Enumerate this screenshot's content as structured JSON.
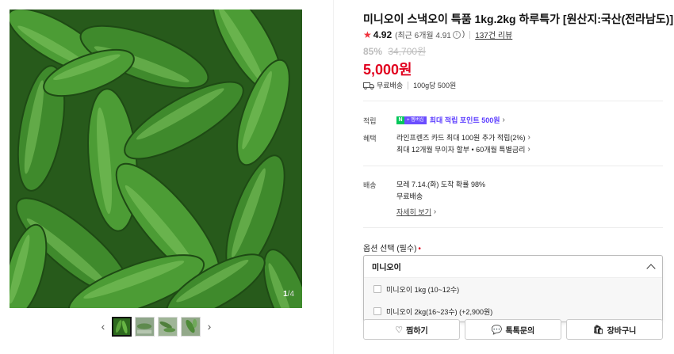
{
  "gallery": {
    "page_current": "1",
    "page_total": "4",
    "page_separator": "/",
    "prev_icon": "chevron-left-icon",
    "next_icon": "chevron-right-icon"
  },
  "product": {
    "title": "미니오이 스낵오이 특품 1kg.2kg 하루특가 [원산지:국산(전라남도)]",
    "rating": "4.92",
    "rating_recent": "(최근 6개월 4.91",
    "rating_recent_close": ")",
    "reviews": "137건 리뷰",
    "discount_rate": "85%",
    "original_price": "34,700원",
    "price": "5,000원",
    "shipping": "무료배송",
    "unit_price": "100g당 500원"
  },
  "benefits": {
    "point_label": "적립",
    "npay_n": "N",
    "npay_plus": "+ 멤버십",
    "point_text": "최대 적립 포인트 500원",
    "benefit_label": "혜택",
    "benefit_line1": "라인프렌즈 카드 최대 100원 추가 적립(2%)",
    "benefit_line2": "최대 12개월 무이자 할부 • 60개월 특별금리"
  },
  "delivery": {
    "label": "배송",
    "eta": "모레 7.14.(화) 도착 확률 98%",
    "fee": "무료배송",
    "detail_link": "자세히 보기"
  },
  "options": {
    "label": "옵션 선택 (필수)",
    "required_mark": "•",
    "selected": "미니오이",
    "items": [
      "미니오이 1kg (10~12수)",
      "미니오이 2kg(16~23수) (+2,900원)"
    ]
  },
  "actions": {
    "wish": "찜하기",
    "talk": "톡톡문의",
    "cart": "장바구니"
  },
  "colors": {
    "price_red": "#e1001f",
    "point_purple": "#5b3cff",
    "npay_green": "#03c75a",
    "cucumber_green": "#3f8a2c"
  }
}
